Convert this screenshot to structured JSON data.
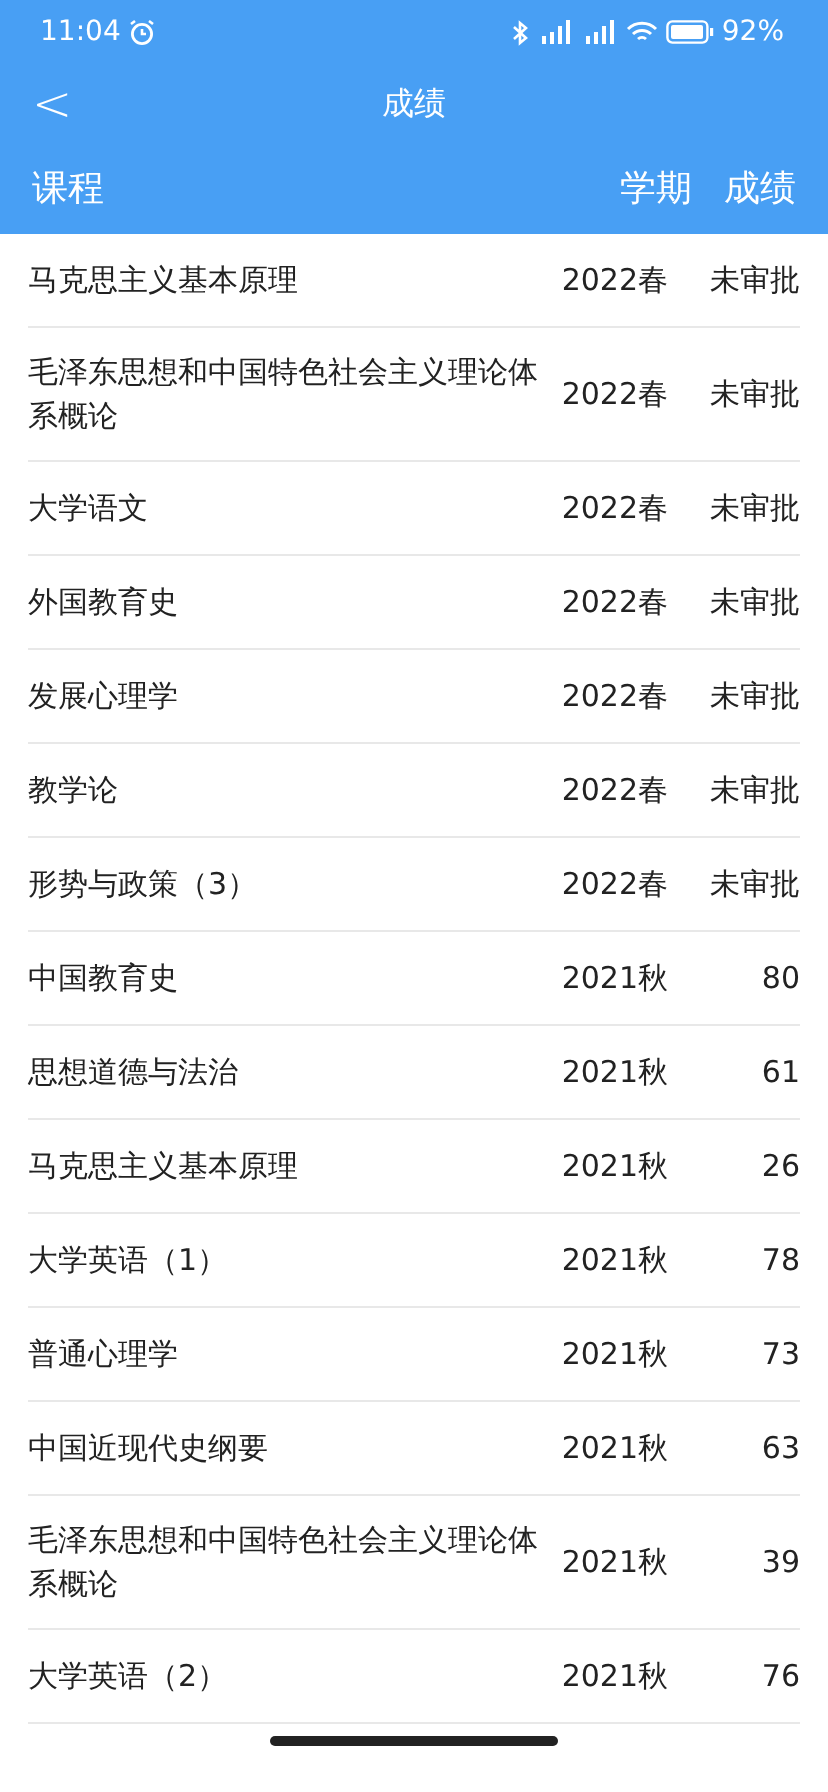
{
  "status_bar": {
    "time": "11:04",
    "battery": "92%"
  },
  "nav": {
    "back": "<",
    "title": "成绩"
  },
  "table": {
    "columns": [
      "课程",
      "学期",
      "成绩"
    ],
    "rows": [
      {
        "course": "马克思主义基本原理",
        "term": "2022春",
        "grade": "未审批"
      },
      {
        "course": "毛泽东思想和中国特色社会主义理论体系概论",
        "term": "2022春",
        "grade": "未审批"
      },
      {
        "course": "大学语文",
        "term": "2022春",
        "grade": "未审批"
      },
      {
        "course": "外国教育史",
        "term": "2022春",
        "grade": "未审批"
      },
      {
        "course": "发展心理学",
        "term": "2022春",
        "grade": "未审批"
      },
      {
        "course": "教学论",
        "term": "2022春",
        "grade": "未审批"
      },
      {
        "course": "形势与政策（3）",
        "term": "2022春",
        "grade": "未审批"
      },
      {
        "course": "中国教育史",
        "term": "2021秋",
        "grade": "80"
      },
      {
        "course": "思想道德与法治",
        "term": "2021秋",
        "grade": "61"
      },
      {
        "course": "马克思主义基本原理",
        "term": "2021秋",
        "grade": "26"
      },
      {
        "course": "大学英语（1）",
        "term": "2021秋",
        "grade": "78"
      },
      {
        "course": "普通心理学",
        "term": "2021秋",
        "grade": "73"
      },
      {
        "course": "中国近现代史纲要",
        "term": "2021秋",
        "grade": "63"
      },
      {
        "course": "毛泽东思想和中国特色社会主义理论体系概论",
        "term": "2021秋",
        "grade": "39"
      },
      {
        "course": "大学英语（2）",
        "term": "2021秋",
        "grade": "76"
      }
    ]
  }
}
